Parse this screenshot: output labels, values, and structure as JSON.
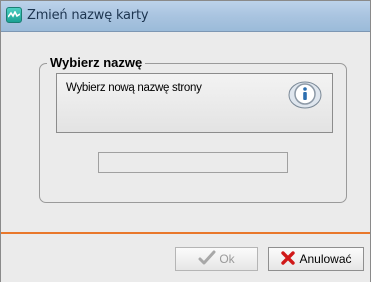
{
  "window": {
    "title": "Zmień nazwę karty",
    "icon": "app-icon"
  },
  "group": {
    "legend": "Wybierz nazwę"
  },
  "info": {
    "text": "Wybierz nową nazwę strony",
    "icon": "info-icon"
  },
  "name_input": {
    "value": "",
    "placeholder": ""
  },
  "buttons": {
    "ok": {
      "label": "Ok",
      "icon": "checkmark-icon",
      "enabled": false
    },
    "cancel": {
      "label": "Anulować",
      "icon": "red-x-icon"
    }
  },
  "colors": {
    "accent_line": "#e9782b",
    "cancel_icon": "#d01818",
    "info_icon": "#2d6fb0"
  }
}
